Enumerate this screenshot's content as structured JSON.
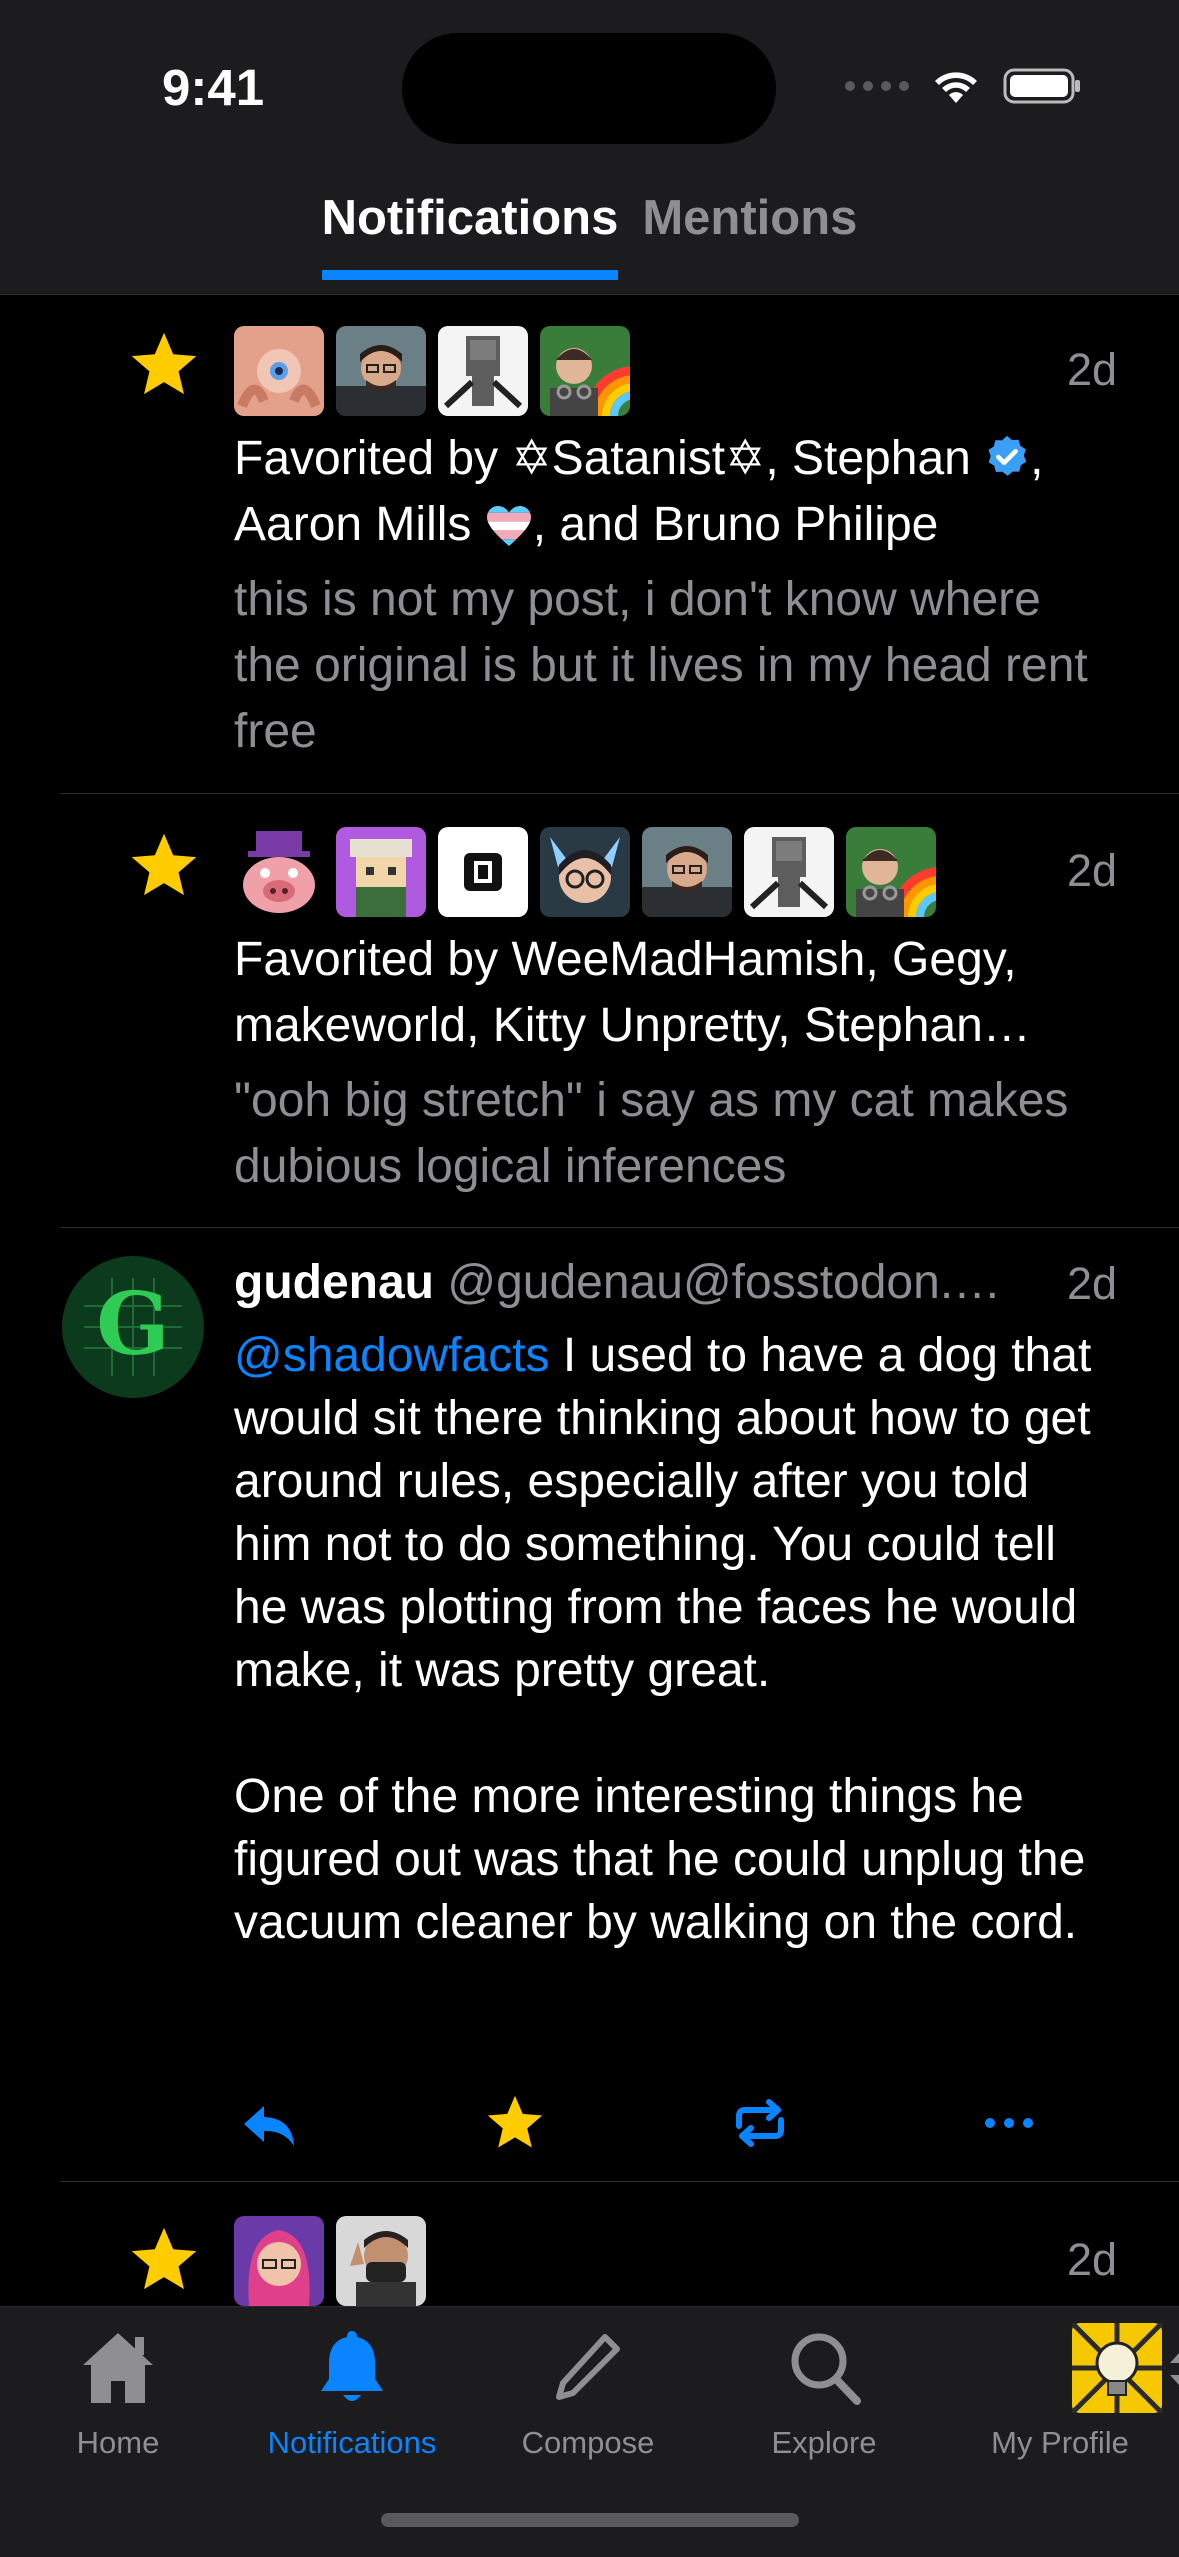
{
  "status_bar": {
    "time": "9:41"
  },
  "header": {
    "tabs": [
      {
        "label": "Notifications",
        "active": true
      },
      {
        "label": "Mentions",
        "active": false
      }
    ]
  },
  "notifications": [
    {
      "type": "favorite",
      "time": "2d",
      "text_prefix": "Favorited by ",
      "names": [
        "✡Satanist✡",
        "Stephan",
        "Aaron Mills",
        "Bruno Philipe"
      ],
      "preview": "this is not my post, i don't know where the original is but it lives in my head rent free"
    },
    {
      "type": "favorite",
      "time": "2d",
      "summary": "Favorited by WeeMadHamish, Gegy, makeworld, Kitty Unpretty, Stephan…",
      "preview": "\"ooh big stretch\" i say as my cat makes dubious logical inferences"
    },
    {
      "type": "mention",
      "author_name": "gudenau",
      "author_handle": "@gudenau@fosstodon.…",
      "time": "2d",
      "mention": "@shadowfacts",
      "body_1": " I used to have a dog that would sit there thinking about how to get around rules, especially after you told him not to do something. You could tell he was plotting from the faces he would make, it was pretty great.",
      "body_2": "One of the more interesting things he figured out was that he could unplug the vacuum cleaner by walking on the cord."
    },
    {
      "type": "favorite",
      "time": "2d"
    }
  ],
  "tabbar": {
    "items": [
      {
        "label": "Home",
        "icon": "house-icon",
        "active": false
      },
      {
        "label": "Notifications",
        "icon": "bell-icon",
        "active": true
      },
      {
        "label": "Compose",
        "icon": "pencil-icon",
        "active": false
      },
      {
        "label": "Explore",
        "icon": "magnifier-icon",
        "active": false
      },
      {
        "label": "My Profile",
        "icon": "avatar-icon",
        "active": false
      }
    ]
  },
  "colors": {
    "accent": "#0a84ff",
    "star": "#ffcc00",
    "background": "#000000",
    "bar": "#1c1c1e",
    "secondary_text": "#8e8e93"
  }
}
